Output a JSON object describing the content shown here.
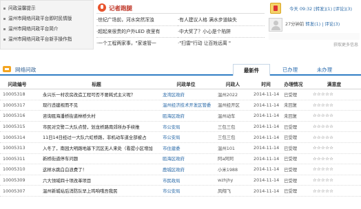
{
  "top_links": [
    "问政温馨提示",
    "温州市网络问政平台即时民情版",
    "温州市网络问政平台简介",
    "温州市网络问政平台新手操作指"
  ],
  "journalist": {
    "title": "记者跑腿",
    "items": [
      "·世纪广场前，河水突然浑浊",
      "·有人建议人格 满水步道缺失",
      "·超起来很贵的户外LED 夜里有",
      "·中大奖了？小心是个陷阱",
      "·一个工程两家事，\"家谁管一",
      "·\"扫雷\"行动 让百姓远离 \""
    ]
  },
  "user_widget": {
    "line1_prefix": "今天 09:32 ",
    "line1_links": "[转发](1) [评论](3)",
    "line2_prefix": "27分钟前",
    "line2_links": "转发(1) | 评论(3)",
    "more_link": "获取更多信息"
  },
  "tabs": {
    "section_title": "网络问政",
    "items": [
      "最新件",
      "已办理",
      "未办理"
    ]
  },
  "table": {
    "headers": [
      "问政编号",
      "标题",
      "问政单位",
      "问政人",
      "时间",
      "办理情况",
      "满意度"
    ],
    "stars": "☆☆☆☆☆",
    "rows": [
      {
        "id": "10005318",
        "title": "永兴乐一村农房改造工程可否不要耗式主义呢？",
        "unit": "龙湾区政府",
        "person": "温州2022",
        "date": "2014-11-14",
        "status": "已受理"
      },
      {
        "id": "10005317",
        "title": "现行违建视而不见",
        "unit": "温州经济技术开发区管委",
        "person": "温州经开区",
        "date": "2014-11-14",
        "status": "未回复"
      },
      {
        "id": "10005316",
        "title": "咨询瓯海潘桥街道林桥头村",
        "unit": "瓯海区政府",
        "person": "温州动车",
        "date": "2014-11-14",
        "status": "未回复"
      },
      {
        "id": "10005315",
        "title": "市民对交警二大队点赞，划龙桥路南郊所办手续推",
        "unit": "市公安局",
        "person": "三包三包",
        "date": "2014-11-14",
        "status": "已受理"
      },
      {
        "id": "10005314",
        "title": "11日14日经过一大队六虹桥路，非机动车道全部被占",
        "unit": "市公安局",
        "person": "三包三包",
        "date": "2014-11-14",
        "status": "已受理"
      },
      {
        "id": "10005313",
        "title": "入冬了，南园大明路地基下沉区无人来处（看提小区增加",
        "unit": "市住建委",
        "person": "温州101",
        "date": "2014-11-14",
        "status": "已受理"
      },
      {
        "id": "10005311",
        "title": "新桥街道停车问题",
        "unit": "瓯海区政府",
        "person": "阿a阿阿",
        "date": "2014-11-14",
        "status": "已受理"
      },
      {
        "id": "10005310",
        "title": "这样水跳白白浪费了！",
        "unit": "鹿城区政府",
        "person": "小米1988",
        "date": "2014-11-14",
        "status": "已受理"
      },
      {
        "id": "10005309",
        "title": "六大领域四十项改革项目",
        "unit": "市民政局",
        "person": "wzhjhy",
        "date": "2014-11-14",
        "status": "已受理"
      },
      {
        "id": "10005307",
        "title": "温州新城站后消防队早上鸣响哦吾我民",
        "unit": "市公安局",
        "person": "凤翔飞",
        "date": "2014-11-14",
        "status": "已受理"
      }
    ]
  }
}
